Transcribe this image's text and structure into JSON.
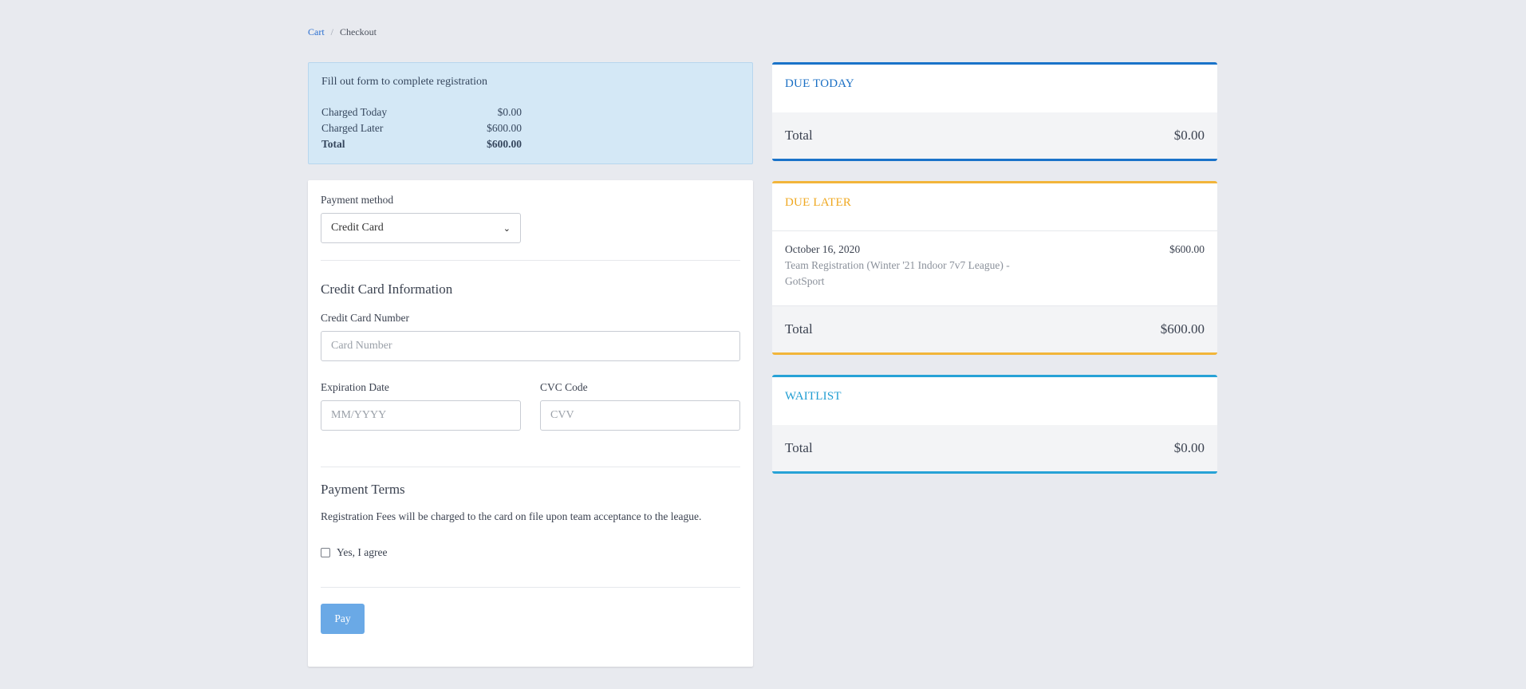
{
  "breadcrumb": {
    "cart": "Cart",
    "sep": "/",
    "current": "Checkout"
  },
  "info": {
    "title": "Fill out form to complete registration",
    "rows": [
      {
        "label": "Charged Today",
        "value": "$0.00"
      },
      {
        "label": "Charged Later",
        "value": "$600.00"
      },
      {
        "label": "Total",
        "value": "$600.00"
      }
    ]
  },
  "form": {
    "payment_method_label": "Payment method",
    "payment_method_value": "Credit Card",
    "cc_heading": "Credit Card Information",
    "cc_number_label": "Credit Card Number",
    "cc_number_placeholder": "Card Number",
    "exp_label": "Expiration Date",
    "exp_placeholder": "MM/YYYY",
    "cvc_label": "CVC Code",
    "cvc_placeholder": "CVV",
    "terms_heading": "Payment Terms",
    "terms_text": "Registration Fees will be charged to the card on file upon team acceptance to the league.",
    "agree_label": "Yes, I agree",
    "agree_checked": false,
    "pay_label": "Pay"
  },
  "panels": {
    "due_today": {
      "title": "DUE TODAY",
      "total_label": "Total",
      "total_value": "$0.00",
      "color": "#1a73c9"
    },
    "due_later": {
      "title": "DUE LATER",
      "item": {
        "date": "October 16, 2020",
        "description": "Team Registration (Winter '21 Indoor 7v7 League) - GotSport",
        "amount": "$600.00"
      },
      "total_label": "Total",
      "total_value": "$600.00",
      "color": "#f2b53a"
    },
    "waitlist": {
      "title": "WAITLIST",
      "total_label": "Total",
      "total_value": "$0.00",
      "color": "#27a2d6"
    }
  }
}
